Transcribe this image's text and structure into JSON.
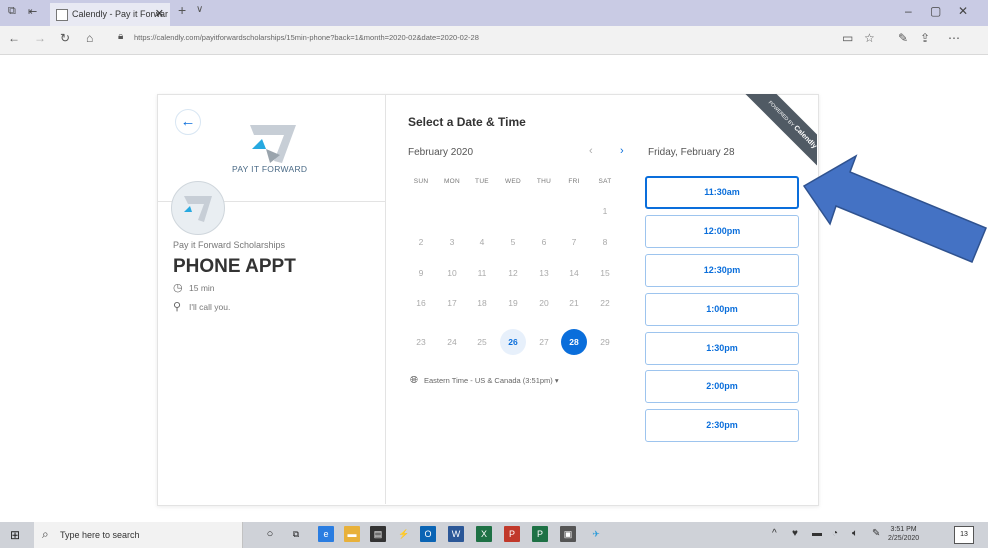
{
  "browser": {
    "tab_title": "Calendly - Pay it Forwar",
    "tab_close": "✕",
    "new_tab": "+",
    "tab_menu": "∨",
    "url": "https://calendly.com/payitforwardscholarships/15min-phone?back=1&month=2020-02&date=2020-02-28",
    "window_controls": [
      "–",
      "▢",
      "✕"
    ]
  },
  "left": {
    "back_icon": "←",
    "logo_text": "PAY IT FORWARD",
    "organization": "Pay it Forward Scholarships",
    "event_name": "PHONE APPT",
    "duration": "15 min",
    "location": "I'll call you."
  },
  "calendar": {
    "title": "Select a Date & Time",
    "month": "February 2020",
    "prev_icon": "‹",
    "next_icon": "›",
    "weekdays": [
      "SUN",
      "MON",
      "TUE",
      "WED",
      "THU",
      "FRI",
      "SAT"
    ],
    "weeks": [
      [
        "",
        "",
        "",
        "",
        "",
        "",
        "1"
      ],
      [
        "2",
        "3",
        "4",
        "5",
        "6",
        "7",
        "8"
      ],
      [
        "9",
        "10",
        "11",
        "12",
        "13",
        "14",
        "15"
      ],
      [
        "16",
        "17",
        "18",
        "19",
        "20",
        "21",
        "22"
      ],
      [
        "23",
        "24",
        "25",
        "26",
        "27",
        "28",
        "29"
      ]
    ],
    "available_days": [
      "26"
    ],
    "selected_day": "28",
    "timezone": "Eastern Time - US & Canada (3:51pm) ▾"
  },
  "times": {
    "date_heading": "Friday, February 28",
    "slots": [
      "11:30am",
      "12:00pm",
      "12:30pm",
      "1:00pm",
      "1:30pm",
      "2:00pm",
      "2:30pm"
    ]
  },
  "ribbon": {
    "line1": "POWERED BY",
    "line2": "Calendly"
  },
  "taskbar": {
    "search_placeholder": "Type here to search",
    "time": "3:51 PM",
    "date": "2/25/2020",
    "notif_count": "13"
  },
  "colors": {
    "accent": "#0a6edb",
    "annotation_arrow": "#4472c4"
  }
}
